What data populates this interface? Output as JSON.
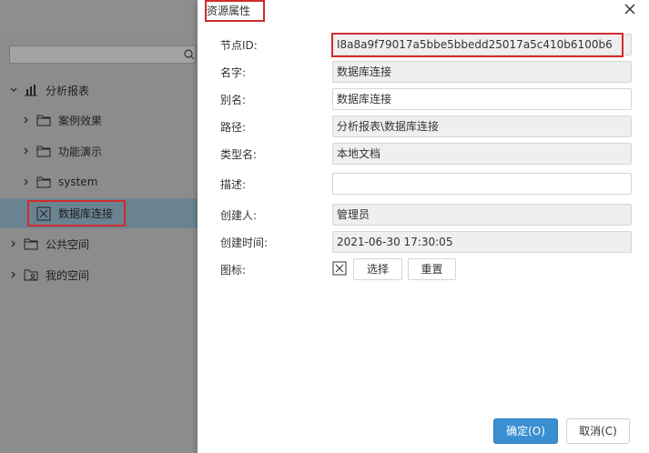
{
  "tree": {
    "items": [
      {
        "label": "分析报表",
        "icon": "bar-chart-icon",
        "expanded": true
      },
      {
        "label": "案例效果",
        "icon": "folder-icon"
      },
      {
        "label": "功能演示",
        "icon": "folder-icon"
      },
      {
        "label": "system",
        "icon": "folder-icon"
      },
      {
        "label": "数据库连接",
        "icon": "database-connection-icon",
        "selected": true
      },
      {
        "label": "公共空间",
        "icon": "folder-icon"
      },
      {
        "label": "我的空间",
        "icon": "user-folder-icon"
      }
    ]
  },
  "dialog": {
    "title": "资源属性",
    "fields": {
      "node_id": {
        "label": "节点ID:",
        "value": "I8a8a9f79017a5bbe5bbedd25017a5c410b6100b6"
      },
      "name": {
        "label": "名字:",
        "value": "数据库连接"
      },
      "alias": {
        "label": "别名:",
        "value": "数据库连接"
      },
      "path": {
        "label": "路径:",
        "value": "分析报表\\数据库连接"
      },
      "type_name": {
        "label": "类型名:",
        "value": "本地文档"
      },
      "description": {
        "label": "描述:",
        "value": ""
      },
      "creator": {
        "label": "创建人:",
        "value": "管理员"
      },
      "created_time": {
        "label": "创建时间:",
        "value": "2021-06-30 17:30:05"
      },
      "icon": {
        "label": "图标:",
        "select_label": "选择",
        "reset_label": "重置"
      }
    },
    "ok_label": "确定(O)",
    "cancel_label": "取消(C)"
  },
  "colors": {
    "accent": "#3b8fd0",
    "highlight": "#d12b2b",
    "selected_row": "#6a8391"
  }
}
